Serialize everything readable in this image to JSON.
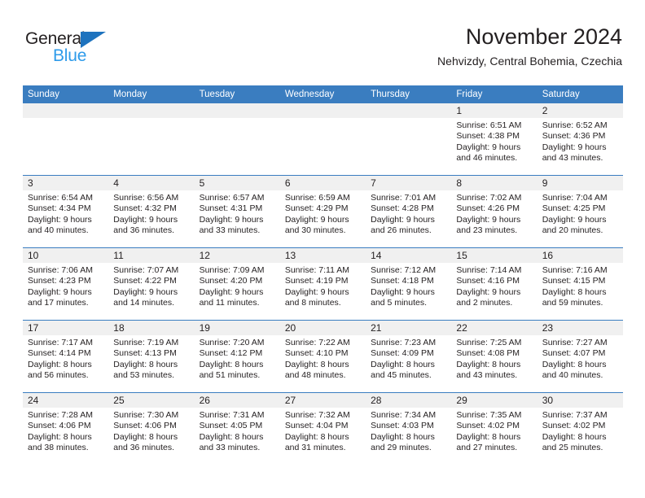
{
  "brand": {
    "name_dark": "General",
    "name_light": "Blue",
    "accent_blue": "#2e9bea",
    "triangle_blue": "#1e73be"
  },
  "header": {
    "title": "November 2024",
    "subtitle": "Nehvizdy, Central Bohemia, Czechia"
  },
  "calendar": {
    "header_bg": "#3a7dc0",
    "daynum_bg": "#f0f0f0",
    "weekday_headers": [
      "Sunday",
      "Monday",
      "Tuesday",
      "Wednesday",
      "Thursday",
      "Friday",
      "Saturday"
    ],
    "weeks": [
      [
        {
          "day": "",
          "empty": true
        },
        {
          "day": "",
          "empty": true
        },
        {
          "day": "",
          "empty": true
        },
        {
          "day": "",
          "empty": true
        },
        {
          "day": "",
          "empty": true
        },
        {
          "day": "1",
          "sunrise": "Sunrise: 6:51 AM",
          "sunset": "Sunset: 4:38 PM",
          "daylight_1": "Daylight: 9 hours",
          "daylight_2": "and 46 minutes."
        },
        {
          "day": "2",
          "sunrise": "Sunrise: 6:52 AM",
          "sunset": "Sunset: 4:36 PM",
          "daylight_1": "Daylight: 9 hours",
          "daylight_2": "and 43 minutes."
        }
      ],
      [
        {
          "day": "3",
          "sunrise": "Sunrise: 6:54 AM",
          "sunset": "Sunset: 4:34 PM",
          "daylight_1": "Daylight: 9 hours",
          "daylight_2": "and 40 minutes."
        },
        {
          "day": "4",
          "sunrise": "Sunrise: 6:56 AM",
          "sunset": "Sunset: 4:32 PM",
          "daylight_1": "Daylight: 9 hours",
          "daylight_2": "and 36 minutes."
        },
        {
          "day": "5",
          "sunrise": "Sunrise: 6:57 AM",
          "sunset": "Sunset: 4:31 PM",
          "daylight_1": "Daylight: 9 hours",
          "daylight_2": "and 33 minutes."
        },
        {
          "day": "6",
          "sunrise": "Sunrise: 6:59 AM",
          "sunset": "Sunset: 4:29 PM",
          "daylight_1": "Daylight: 9 hours",
          "daylight_2": "and 30 minutes."
        },
        {
          "day": "7",
          "sunrise": "Sunrise: 7:01 AM",
          "sunset": "Sunset: 4:28 PM",
          "daylight_1": "Daylight: 9 hours",
          "daylight_2": "and 26 minutes."
        },
        {
          "day": "8",
          "sunrise": "Sunrise: 7:02 AM",
          "sunset": "Sunset: 4:26 PM",
          "daylight_1": "Daylight: 9 hours",
          "daylight_2": "and 23 minutes."
        },
        {
          "day": "9",
          "sunrise": "Sunrise: 7:04 AM",
          "sunset": "Sunset: 4:25 PM",
          "daylight_1": "Daylight: 9 hours",
          "daylight_2": "and 20 minutes."
        }
      ],
      [
        {
          "day": "10",
          "sunrise": "Sunrise: 7:06 AM",
          "sunset": "Sunset: 4:23 PM",
          "daylight_1": "Daylight: 9 hours",
          "daylight_2": "and 17 minutes."
        },
        {
          "day": "11",
          "sunrise": "Sunrise: 7:07 AM",
          "sunset": "Sunset: 4:22 PM",
          "daylight_1": "Daylight: 9 hours",
          "daylight_2": "and 14 minutes."
        },
        {
          "day": "12",
          "sunrise": "Sunrise: 7:09 AM",
          "sunset": "Sunset: 4:20 PM",
          "daylight_1": "Daylight: 9 hours",
          "daylight_2": "and 11 minutes."
        },
        {
          "day": "13",
          "sunrise": "Sunrise: 7:11 AM",
          "sunset": "Sunset: 4:19 PM",
          "daylight_1": "Daylight: 9 hours",
          "daylight_2": "and 8 minutes."
        },
        {
          "day": "14",
          "sunrise": "Sunrise: 7:12 AM",
          "sunset": "Sunset: 4:18 PM",
          "daylight_1": "Daylight: 9 hours",
          "daylight_2": "and 5 minutes."
        },
        {
          "day": "15",
          "sunrise": "Sunrise: 7:14 AM",
          "sunset": "Sunset: 4:16 PM",
          "daylight_1": "Daylight: 9 hours",
          "daylight_2": "and 2 minutes."
        },
        {
          "day": "16",
          "sunrise": "Sunrise: 7:16 AM",
          "sunset": "Sunset: 4:15 PM",
          "daylight_1": "Daylight: 8 hours",
          "daylight_2": "and 59 minutes."
        }
      ],
      [
        {
          "day": "17",
          "sunrise": "Sunrise: 7:17 AM",
          "sunset": "Sunset: 4:14 PM",
          "daylight_1": "Daylight: 8 hours",
          "daylight_2": "and 56 minutes."
        },
        {
          "day": "18",
          "sunrise": "Sunrise: 7:19 AM",
          "sunset": "Sunset: 4:13 PM",
          "daylight_1": "Daylight: 8 hours",
          "daylight_2": "and 53 minutes."
        },
        {
          "day": "19",
          "sunrise": "Sunrise: 7:20 AM",
          "sunset": "Sunset: 4:12 PM",
          "daylight_1": "Daylight: 8 hours",
          "daylight_2": "and 51 minutes."
        },
        {
          "day": "20",
          "sunrise": "Sunrise: 7:22 AM",
          "sunset": "Sunset: 4:10 PM",
          "daylight_1": "Daylight: 8 hours",
          "daylight_2": "and 48 minutes."
        },
        {
          "day": "21",
          "sunrise": "Sunrise: 7:23 AM",
          "sunset": "Sunset: 4:09 PM",
          "daylight_1": "Daylight: 8 hours",
          "daylight_2": "and 45 minutes."
        },
        {
          "day": "22",
          "sunrise": "Sunrise: 7:25 AM",
          "sunset": "Sunset: 4:08 PM",
          "daylight_1": "Daylight: 8 hours",
          "daylight_2": "and 43 minutes."
        },
        {
          "day": "23",
          "sunrise": "Sunrise: 7:27 AM",
          "sunset": "Sunset: 4:07 PM",
          "daylight_1": "Daylight: 8 hours",
          "daylight_2": "and 40 minutes."
        }
      ],
      [
        {
          "day": "24",
          "sunrise": "Sunrise: 7:28 AM",
          "sunset": "Sunset: 4:06 PM",
          "daylight_1": "Daylight: 8 hours",
          "daylight_2": "and 38 minutes."
        },
        {
          "day": "25",
          "sunrise": "Sunrise: 7:30 AM",
          "sunset": "Sunset: 4:06 PM",
          "daylight_1": "Daylight: 8 hours",
          "daylight_2": "and 36 minutes."
        },
        {
          "day": "26",
          "sunrise": "Sunrise: 7:31 AM",
          "sunset": "Sunset: 4:05 PM",
          "daylight_1": "Daylight: 8 hours",
          "daylight_2": "and 33 minutes."
        },
        {
          "day": "27",
          "sunrise": "Sunrise: 7:32 AM",
          "sunset": "Sunset: 4:04 PM",
          "daylight_1": "Daylight: 8 hours",
          "daylight_2": "and 31 minutes."
        },
        {
          "day": "28",
          "sunrise": "Sunrise: 7:34 AM",
          "sunset": "Sunset: 4:03 PM",
          "daylight_1": "Daylight: 8 hours",
          "daylight_2": "and 29 minutes."
        },
        {
          "day": "29",
          "sunrise": "Sunrise: 7:35 AM",
          "sunset": "Sunset: 4:02 PM",
          "daylight_1": "Daylight: 8 hours",
          "daylight_2": "and 27 minutes."
        },
        {
          "day": "30",
          "sunrise": "Sunrise: 7:37 AM",
          "sunset": "Sunset: 4:02 PM",
          "daylight_1": "Daylight: 8 hours",
          "daylight_2": "and 25 minutes."
        }
      ]
    ]
  }
}
